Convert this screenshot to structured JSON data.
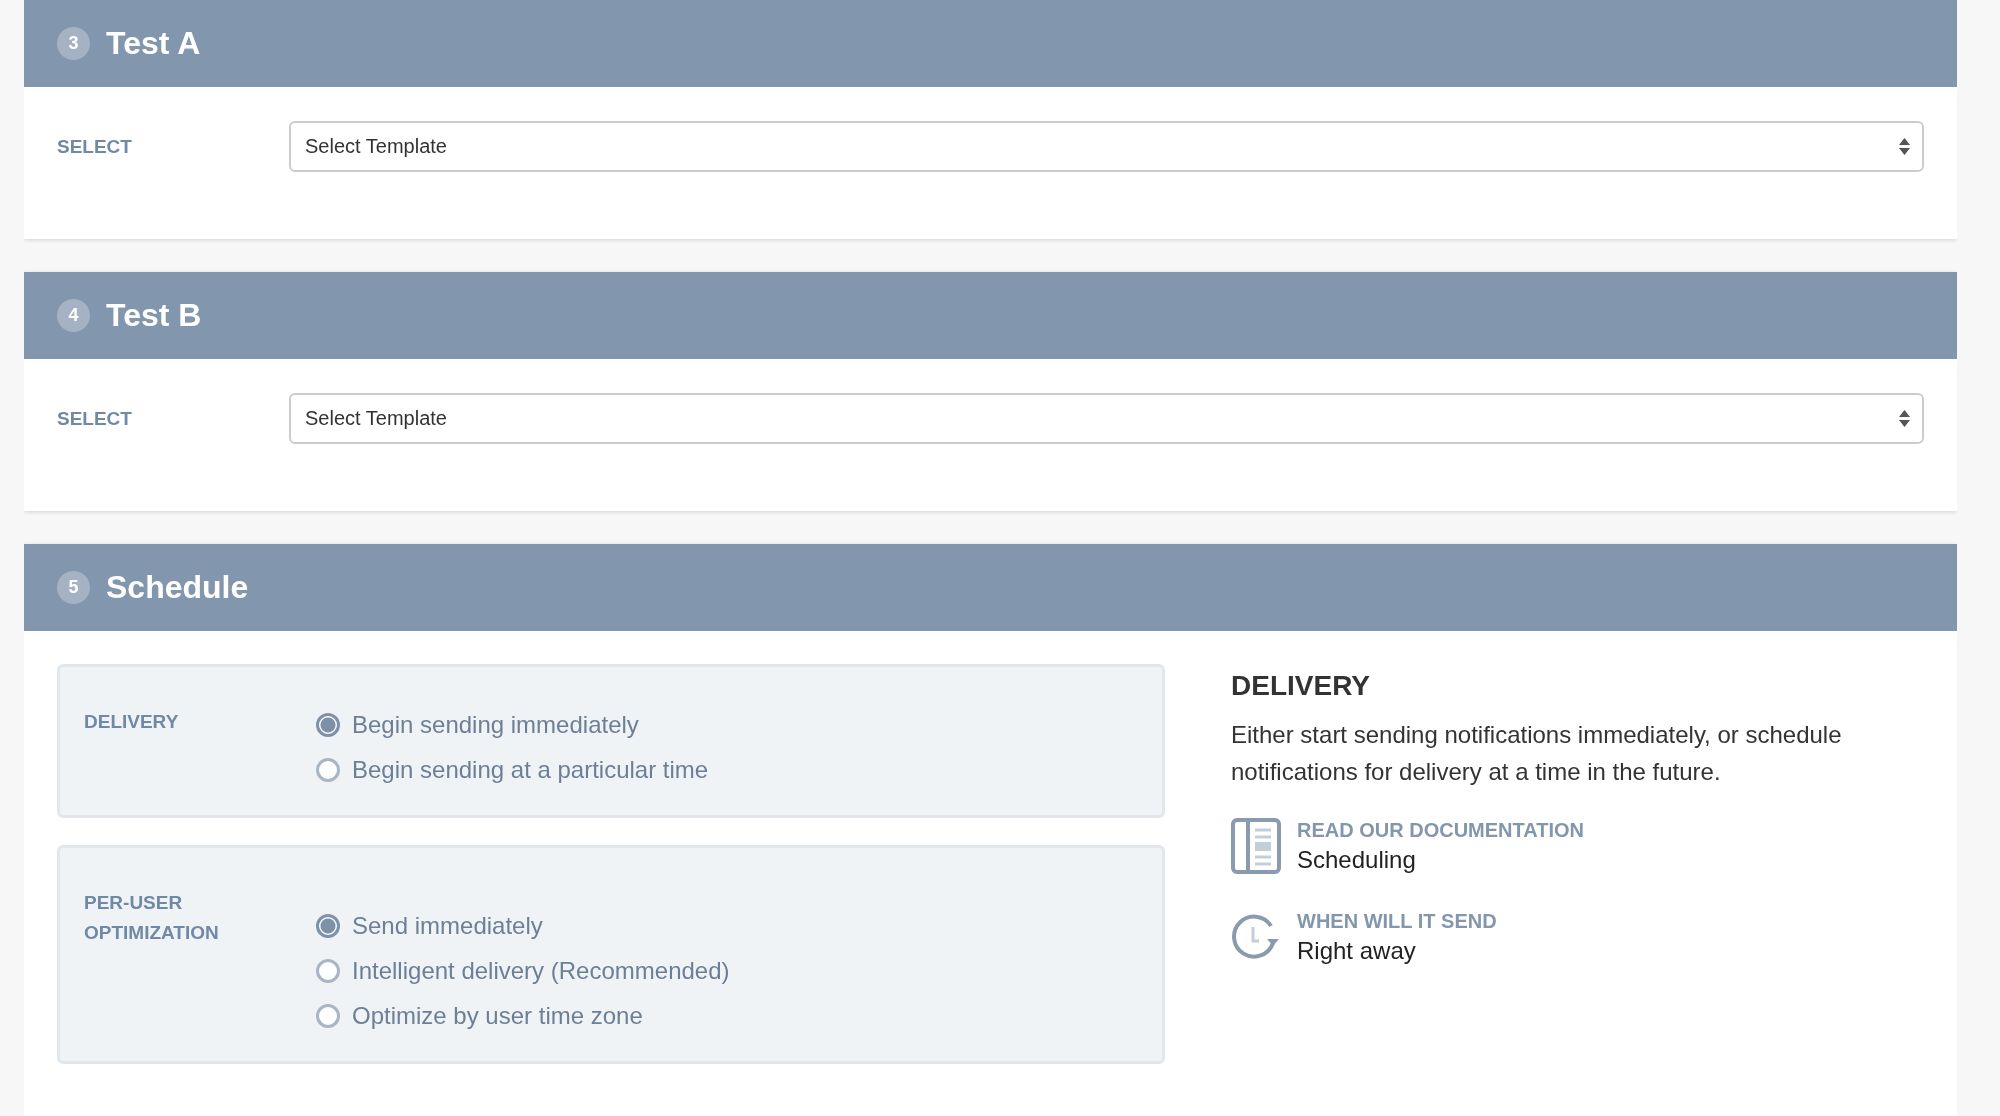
{
  "sections": [
    {
      "number": "3",
      "title": "Test A",
      "kind": "select",
      "label": "SELECT",
      "select": {
        "value": "Select Template"
      }
    },
    {
      "number": "4",
      "title": "Test B",
      "kind": "select",
      "label": "SELECT",
      "select": {
        "value": "Select Template"
      }
    },
    {
      "number": "5",
      "title": "Schedule",
      "kind": "schedule",
      "groups": [
        {
          "label": "DELIVERY",
          "options": [
            {
              "label": "Begin sending immediately",
              "selected": true
            },
            {
              "label": "Begin sending at a particular time",
              "selected": false
            }
          ]
        },
        {
          "label": "PER-USER OPTIMIZATION",
          "options": [
            {
              "label": "Send immediately",
              "selected": true
            },
            {
              "label": "Intelligent delivery (Recommended)",
              "selected": false
            },
            {
              "label": "Optimize by user time zone",
              "selected": false
            }
          ]
        }
      ],
      "info": {
        "title": "DELIVERY",
        "text": "Either start sending notifications immediately, or schedule notifications for delivery at a time in the future.",
        "items": [
          {
            "kind": "docs",
            "label": "READ OUR DOCUMENTATION",
            "value": "Scheduling"
          },
          {
            "kind": "clock",
            "label": "WHEN WILL IT SEND",
            "value": "Right away"
          }
        ]
      }
    }
  ]
}
